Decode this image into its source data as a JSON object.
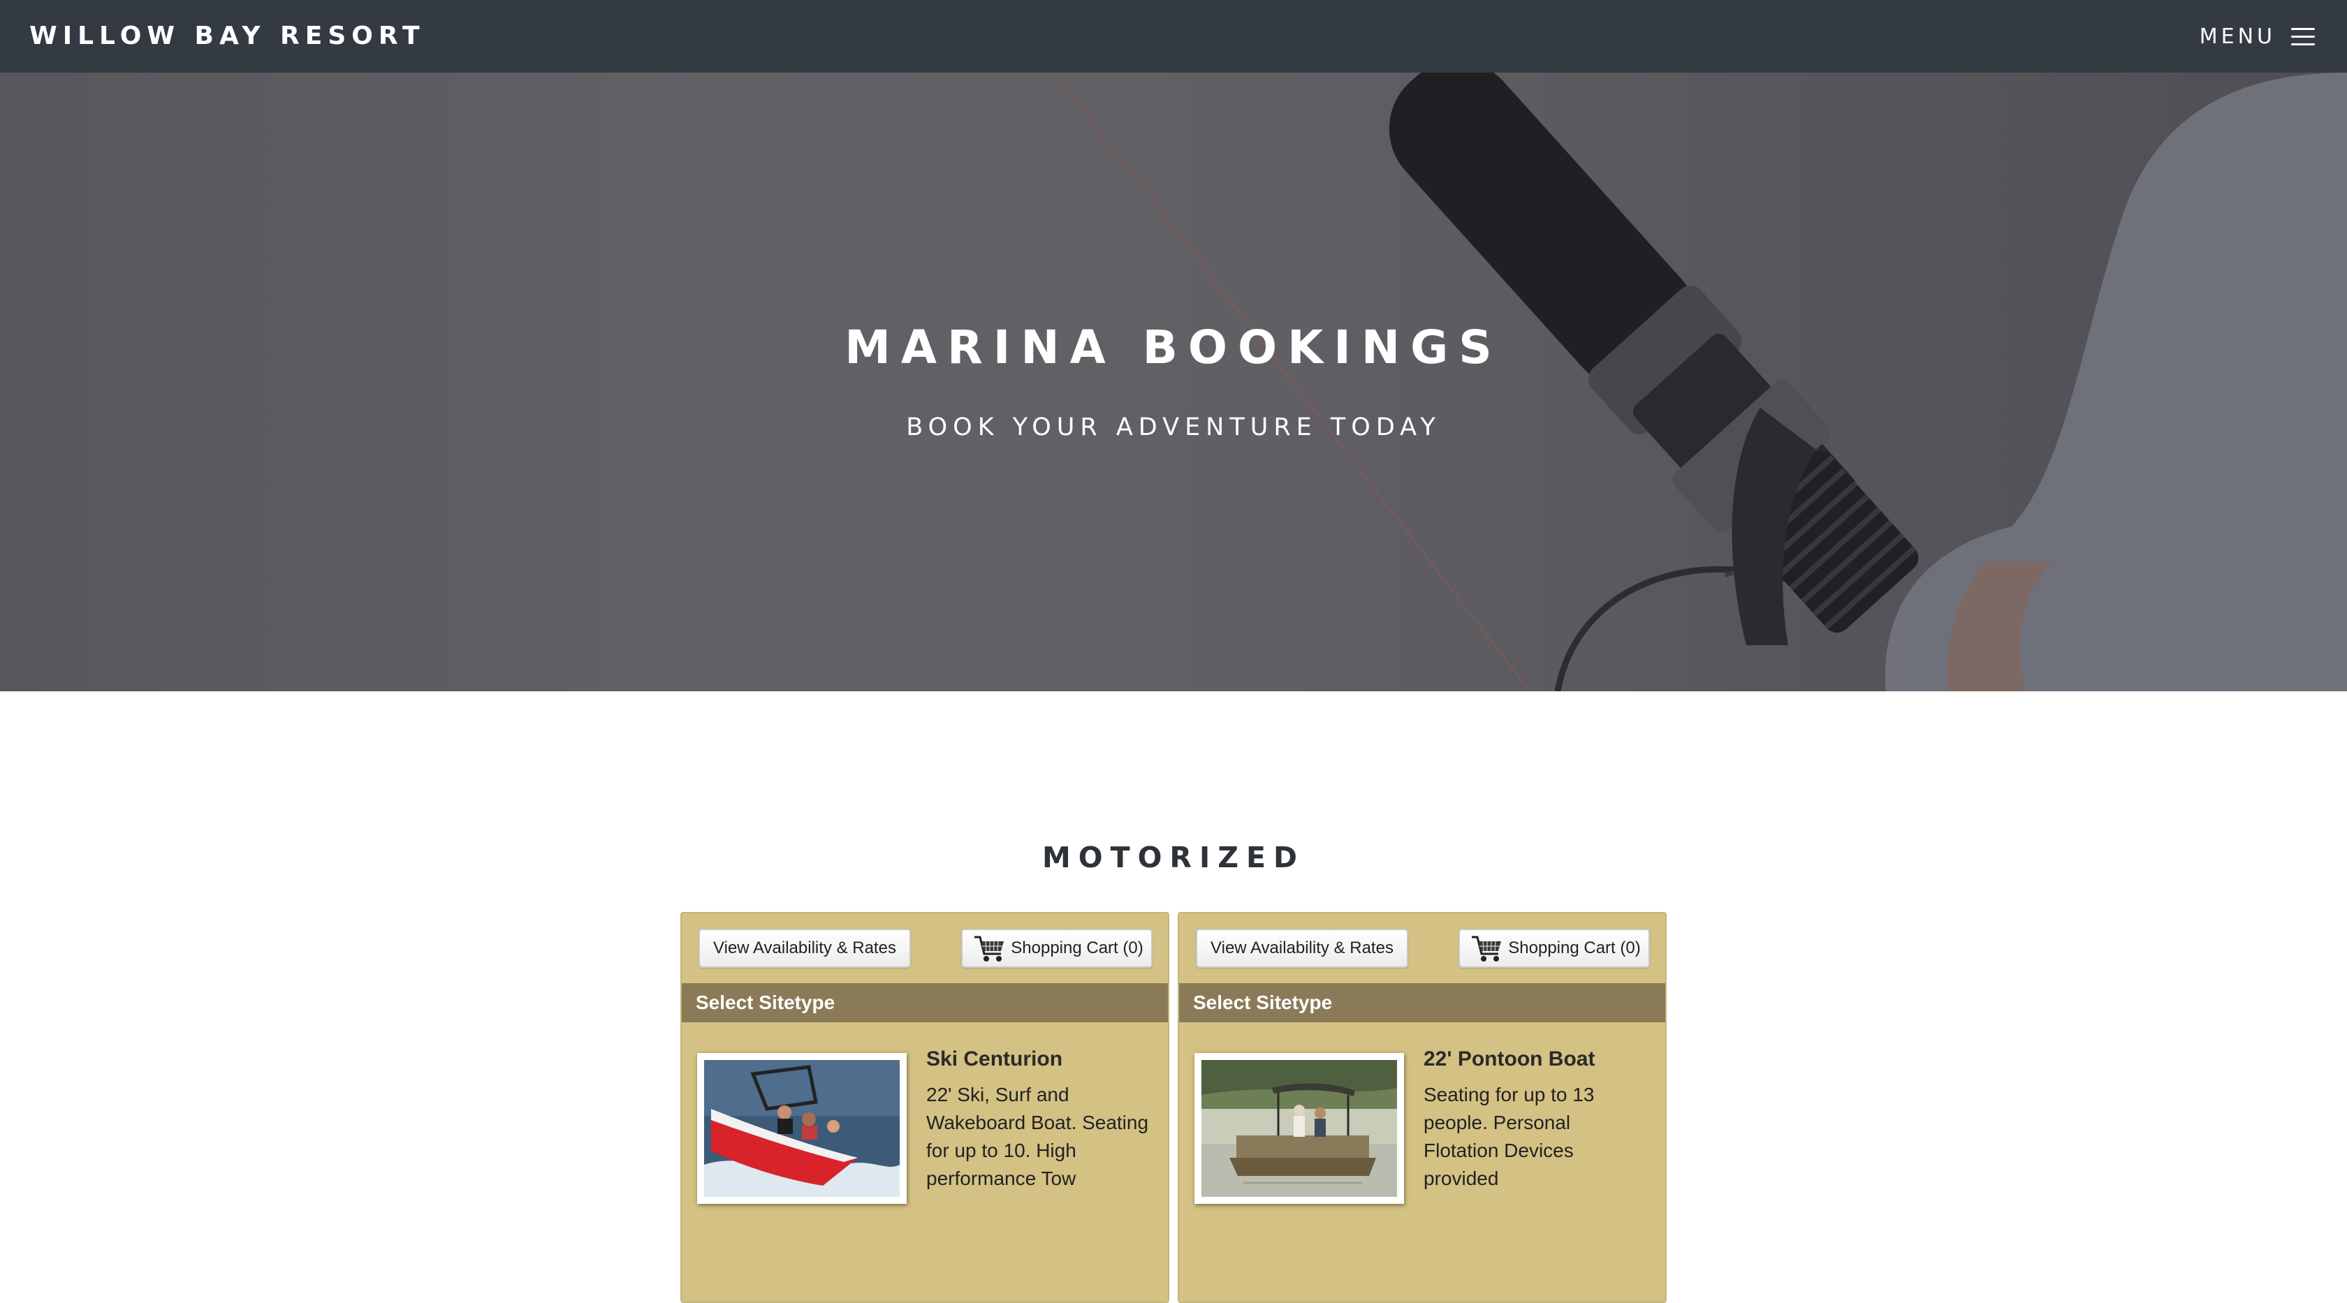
{
  "nav": {
    "brand": "WILLOW BAY RESORT",
    "menu_label": "MENU"
  },
  "hero": {
    "title": "MARINA BOOKINGS",
    "subtitle": "BOOK YOUR ADVENTURE TODAY"
  },
  "section": {
    "title": "MOTORIZED"
  },
  "cards": [
    {
      "availability_label": "View Availability & Rates",
      "cart_label": "Shopping Cart (0)",
      "bar_label": "Select Sitetype",
      "name": "Ski Centurion",
      "description": "22' Ski, Surf and Wakeboard Boat. Seating for up to 10. High performance Tow"
    },
    {
      "availability_label": "View Availability & Rates",
      "cart_label": "Shopping Cart (0)",
      "bar_label": "Select Sitetype",
      "name": "22' Pontoon Boat",
      "description": "Seating for up to 13 people. Personal Flotation Devices provided"
    }
  ],
  "colors": {
    "nav_bg": "#343a42",
    "card_bg": "#d4c184",
    "card_bar": "#8b7a57",
    "heading": "#2e333a"
  }
}
